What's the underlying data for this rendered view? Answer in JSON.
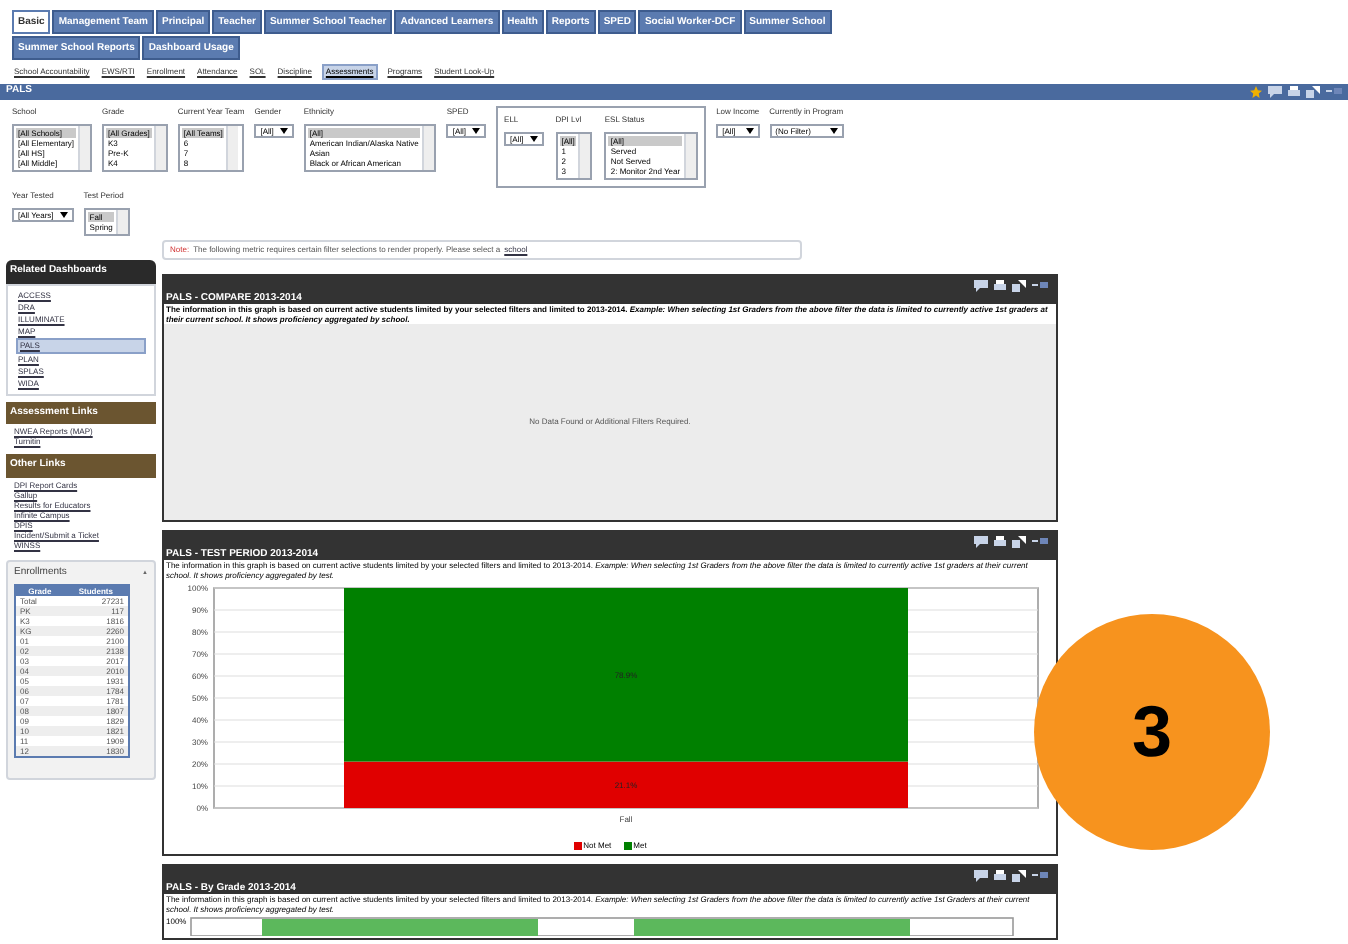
{
  "nav_rows": [
    [
      {
        "label": "Basic",
        "selected": true
      },
      {
        "label": "Management Team",
        "selected": false
      },
      {
        "label": "Principal",
        "selected": false
      },
      {
        "label": "Teacher",
        "selected": false
      },
      {
        "label": "Summer School Teacher",
        "selected": false
      },
      {
        "label": "Advanced Learners",
        "selected": false
      },
      {
        "label": "Health",
        "selected": false
      },
      {
        "label": "Reports",
        "selected": false
      },
      {
        "label": "SPED",
        "selected": false
      },
      {
        "label": "Social Worker-DCF",
        "selected": false
      },
      {
        "label": "Summer School",
        "selected": false
      }
    ],
    [
      {
        "label": "Summer School Reports",
        "selected": false
      },
      {
        "label": "Dashboard Usage",
        "selected": false
      }
    ]
  ],
  "sub_links": [
    {
      "label": "School Accountability",
      "selected": false
    },
    {
      "label": "EWS/RTI",
      "selected": false
    },
    {
      "label": "Enrollment",
      "selected": false
    },
    {
      "label": "Attendance",
      "selected": false
    },
    {
      "label": "SOL",
      "selected": false
    },
    {
      "label": "Discipline",
      "selected": false
    },
    {
      "label": "Assessments",
      "selected": true
    },
    {
      "label": "Programs",
      "selected": false
    },
    {
      "label": "Student Look-Up",
      "selected": false
    }
  ],
  "title_bar": {
    "title": "PALS"
  },
  "filters": [
    {
      "kind": "listbox",
      "label": "School",
      "options": [
        {
          "label": "[All Schools]",
          "selected": true
        },
        {
          "label": "[All Elementary]",
          "selected": false
        },
        {
          "label": "[All HS]",
          "selected": false
        },
        {
          "label": "[All Middle]",
          "selected": false
        }
      ]
    },
    {
      "kind": "listbox",
      "label": "Grade",
      "options": [
        {
          "label": "[All Grades]",
          "selected": true
        },
        {
          "label": "K3",
          "selected": false
        },
        {
          "label": "Pre-K",
          "selected": false
        },
        {
          "label": "K4",
          "selected": false
        }
      ]
    },
    {
      "kind": "listbox",
      "label": "Current Year Team",
      "options": [
        {
          "label": "[All Teams]",
          "selected": true
        },
        {
          "label": "6",
          "selected": false
        },
        {
          "label": "7",
          "selected": false
        },
        {
          "label": "8",
          "selected": false
        }
      ]
    },
    {
      "kind": "dropdown",
      "label": "Gender",
      "value": "[All]"
    },
    {
      "kind": "listbox",
      "label": "Ethnicity",
      "options": [
        {
          "label": "[All]",
          "selected": true
        },
        {
          "label": "American Indian/Alaska Native",
          "selected": false
        },
        {
          "label": "Asian",
          "selected": false
        },
        {
          "label": "Black or African American",
          "selected": false
        }
      ]
    },
    {
      "kind": "dropdown",
      "label": "SPED",
      "value": "[All]"
    },
    {
      "kind": "group",
      "children": [
        {
          "kind": "dropdown",
          "label": "ELL",
          "value": "[All]"
        },
        {
          "kind": "listbox",
          "label": "DPI Lvl",
          "options": [
            {
              "label": "[All]",
              "selected": true
            },
            {
              "label": "1",
              "selected": false
            },
            {
              "label": "2",
              "selected": false
            },
            {
              "label": "3",
              "selected": false
            }
          ]
        },
        {
          "kind": "listbox",
          "label": "ESL Status",
          "options": [
            {
              "label": "[All]",
              "selected": true
            },
            {
              "label": "Served",
              "selected": false
            },
            {
              "label": "Not Served",
              "selected": false
            },
            {
              "label": "2: Monitor 2nd Year",
              "selected": false
            }
          ]
        }
      ]
    },
    {
      "kind": "dropdown",
      "label": "Low Income",
      "value": "[All]"
    },
    {
      "kind": "dropdown",
      "label": "Currently in Program",
      "value": "(No Filter)"
    }
  ],
  "filters_row2": [
    {
      "kind": "dropdown",
      "label": "Year Tested",
      "value": "[All Years]"
    },
    {
      "kind": "listbox",
      "label": "Test Period",
      "options": [
        {
          "label": "Fall",
          "selected": true
        },
        {
          "label": "Spring",
          "selected": false
        }
      ]
    }
  ],
  "note": {
    "prefix": "Note:",
    "text": "The following metric requires certain filter selections to render properly. Please select a",
    "link": "school"
  },
  "sidebar": {
    "related": {
      "title": "Related Dashboards",
      "items": [
        {
          "label": "ACCESS",
          "selected": false
        },
        {
          "label": "DRA",
          "selected": false
        },
        {
          "label": "ILLUMINATE",
          "selected": false
        },
        {
          "label": "MAP",
          "selected": false
        },
        {
          "label": "PALS",
          "selected": true
        },
        {
          "label": "PLAN",
          "selected": false
        },
        {
          "label": "SPLAS",
          "selected": false
        },
        {
          "label": "WIDA",
          "selected": false
        }
      ]
    },
    "assessment_links": {
      "title": "Assessment Links",
      "items": [
        "NWEA Reports (MAP)",
        "Turnitin"
      ]
    },
    "other_links": {
      "title": "Other Links",
      "items": [
        "DPI Report Cards",
        "Gallup",
        "Results for Educators",
        "Infinite Campus",
        "DPIS",
        "Incident/Submit a Ticket",
        "WINSS"
      ]
    },
    "enrollments": {
      "title": "Enrollments",
      "toggle": "▲",
      "columns": [
        "Grade",
        "Students"
      ],
      "rows": [
        [
          "Total",
          "27231"
        ],
        [
          "PK",
          "117"
        ],
        [
          "K3",
          "1816"
        ],
        [
          "KG",
          "2260"
        ],
        [
          "01",
          "2100"
        ],
        [
          "02",
          "2138"
        ],
        [
          "03",
          "2017"
        ],
        [
          "04",
          "2010"
        ],
        [
          "05",
          "1931"
        ],
        [
          "06",
          "1784"
        ],
        [
          "07",
          "1781"
        ],
        [
          "08",
          "1807"
        ],
        [
          "09",
          "1829"
        ],
        [
          "10",
          "1821"
        ],
        [
          "11",
          "1909"
        ],
        [
          "12",
          "1830"
        ]
      ]
    }
  },
  "panels": [
    {
      "kind": "empty",
      "title": "PALS - COMPARE 2013-2014",
      "description": "The information in this graph is based on current active students limited by your selected filters and limited to 2013-2014. *Example: When selecting 1st Graders from the above filter the data is limited to currently active 1st graders at their current school. It shows proficiency aggregated by school.*",
      "message": "No Data Found or Additional Filters Required."
    },
    {
      "kind": "chart",
      "title": "PALS - TEST PERIOD 2013-2014",
      "description": "The information in this graph is based on current active students limited by your selected filters and limited to 2013-2014. *Example: When selecting 1st Graders from the above filter the data is limited to currently active 1st graders at their current school. It shows proficiency aggregated by test.*",
      "chart_data": {
        "type": "bar",
        "stacked": true,
        "categories": [
          "Fall"
        ],
        "series": [
          {
            "name": "Not Met",
            "color": "#e00000",
            "values": [
              21.1
            ]
          },
          {
            "name": "Met",
            "color": "#008000",
            "values": [
              78.9
            ]
          }
        ],
        "ylim": [
          0,
          100
        ],
        "grid": true,
        "legend": "bottom",
        "yticks": [
          {
            "value": 0,
            "label": "0%"
          },
          {
            "value": 10,
            "label": "10%"
          },
          {
            "value": 20,
            "label": "20%"
          },
          {
            "value": 30,
            "label": "30%"
          },
          {
            "value": 40,
            "label": "40%"
          },
          {
            "value": 50,
            "label": "50%"
          },
          {
            "value": 60,
            "label": "60%"
          },
          {
            "value": 70,
            "label": "70%"
          },
          {
            "value": 80,
            "label": "80%"
          },
          {
            "value": 90,
            "label": "90%"
          },
          {
            "value": 100,
            "label": "100%"
          }
        ],
        "value_labels": [
          "21.1%",
          "78.9%"
        ]
      }
    },
    {
      "kind": "partial",
      "title": "PALS - By Grade 2013-2014",
      "description": "The information in this graph is based on current active students limited by your selected filters and limited to 2013-2014. *Example: When selecting 1st Graders from the above filter the data is limited to currently active 1st Graders at their current school. It shows proficiency aggregated by test.*",
      "tick": "100%"
    }
  ],
  "slide_badge": {
    "number": "3"
  }
}
